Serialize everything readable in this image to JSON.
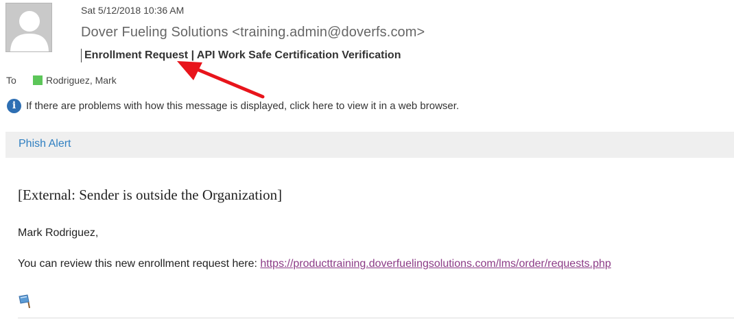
{
  "message": {
    "date": "Sat 5/12/2018 10:36 AM",
    "sender": "Dover Fueling Solutions <training.admin@doverfs.com>",
    "subject": "Enrollment Request | API Work Safe Certification Verification",
    "to_label": "To",
    "recipient": "Rodriguez, Mark",
    "info_bar": "If there are problems with how this message is displayed, click here to view it in a web browser."
  },
  "addin": {
    "phish_alert": "Phish Alert"
  },
  "body": {
    "external_banner": "[External: Sender is outside the Organization]",
    "greeting": "Mark Rodriguez,",
    "review_text": "You can review this new enrollment request here: ",
    "review_link": "https://producttraining.doverfuelingsolutions.com/lms/order/requests.php"
  },
  "icons": {
    "avatar": "person-silhouette-icon",
    "presence": "presence-icon",
    "info": "info-icon",
    "flag": "flag-icon",
    "annotation": "red-arrow"
  },
  "colors": {
    "presence": "#5cc659",
    "info": "#2e6fb3",
    "link": "#8b3a86",
    "phish": "#2f7fc1",
    "arrow": "#e8141b"
  }
}
